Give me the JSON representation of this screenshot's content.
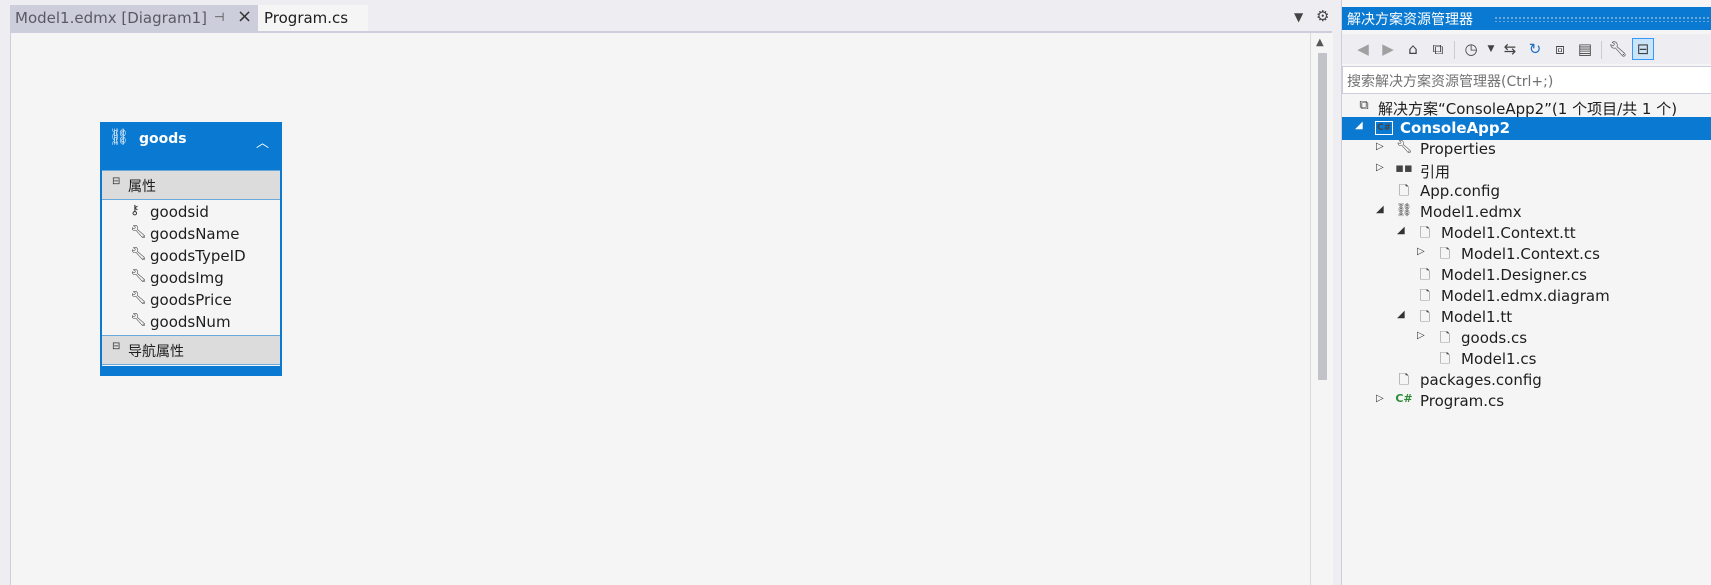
{
  "tabs": [
    {
      "label": "Model1.edmx [Diagram1]",
      "pin_icon": "pin-icon",
      "close_icon": "close-icon"
    },
    {
      "label": "Program.cs"
    }
  ],
  "tab_controls": {
    "dropdown_icon": "chevron-down-icon",
    "settings_icon": "gear-icon"
  },
  "entity": {
    "name": "goods",
    "section_properties": "属性",
    "section_navigation": "导航属性",
    "properties": [
      {
        "name": "goodsid",
        "icon": "key-icon"
      },
      {
        "name": "goodsName",
        "icon": "wrench-icon"
      },
      {
        "name": "goodsTypeID",
        "icon": "wrench-icon"
      },
      {
        "name": "goodsImg",
        "icon": "wrench-icon"
      },
      {
        "name": "goodsPrice",
        "icon": "wrench-icon"
      },
      {
        "name": "goodsNum",
        "icon": "wrench-icon"
      }
    ]
  },
  "solution_explorer": {
    "title": "解决方案资源管理器",
    "search_placeholder": "搜索解决方案资源管理器(Ctrl+;)",
    "toolbar": [
      "back-icon",
      "forward-icon",
      "home-icon",
      "switch-view-icon",
      "pending-changes-icon",
      "sync-icon",
      "refresh-icon",
      "collapse-all-icon",
      "show-all-files-icon",
      "properties-icon",
      "preview-icon"
    ],
    "tree": [
      {
        "label": "解决方案“ConsoleApp2”(1 个项目/共 1 个)",
        "icon": "solution-icon",
        "expander": "none",
        "depth": 0
      },
      {
        "label": "ConsoleApp2",
        "icon": "csharp-project-icon",
        "expander": "expanded",
        "depth": 1,
        "selected": true
      },
      {
        "label": "Properties",
        "icon": "wrench-icon",
        "expander": "collapsed",
        "depth": 2
      },
      {
        "label": "引用",
        "icon": "references-icon",
        "expander": "collapsed",
        "depth": 2
      },
      {
        "label": "App.config",
        "icon": "config-file-icon",
        "expander": "none",
        "depth": 2
      },
      {
        "label": "Model1.edmx",
        "icon": "edmx-icon",
        "expander": "expanded",
        "depth": 2
      },
      {
        "label": "Model1.Context.tt",
        "icon": "template-file-icon",
        "expander": "expanded",
        "depth": 3
      },
      {
        "label": "Model1.Context.cs",
        "icon": "code-file-icon",
        "expander": "collapsed",
        "depth": 4
      },
      {
        "label": "Model1.Designer.cs",
        "icon": "code-file-icon",
        "expander": "none",
        "depth": 3
      },
      {
        "label": "Model1.edmx.diagram",
        "icon": "code-file-icon",
        "expander": "none",
        "depth": 3
      },
      {
        "label": "Model1.tt",
        "icon": "template-file-icon",
        "expander": "expanded",
        "depth": 3
      },
      {
        "label": "goods.cs",
        "icon": "code-file-icon",
        "expander": "collapsed",
        "depth": 4
      },
      {
        "label": "Model1.cs",
        "icon": "code-file-icon",
        "expander": "none",
        "depth": 4
      },
      {
        "label": "packages.config",
        "icon": "config-file-icon",
        "expander": "none",
        "depth": 2
      },
      {
        "label": "Program.cs",
        "icon": "csharp-file-icon",
        "expander": "collapsed",
        "depth": 2
      }
    ]
  }
}
